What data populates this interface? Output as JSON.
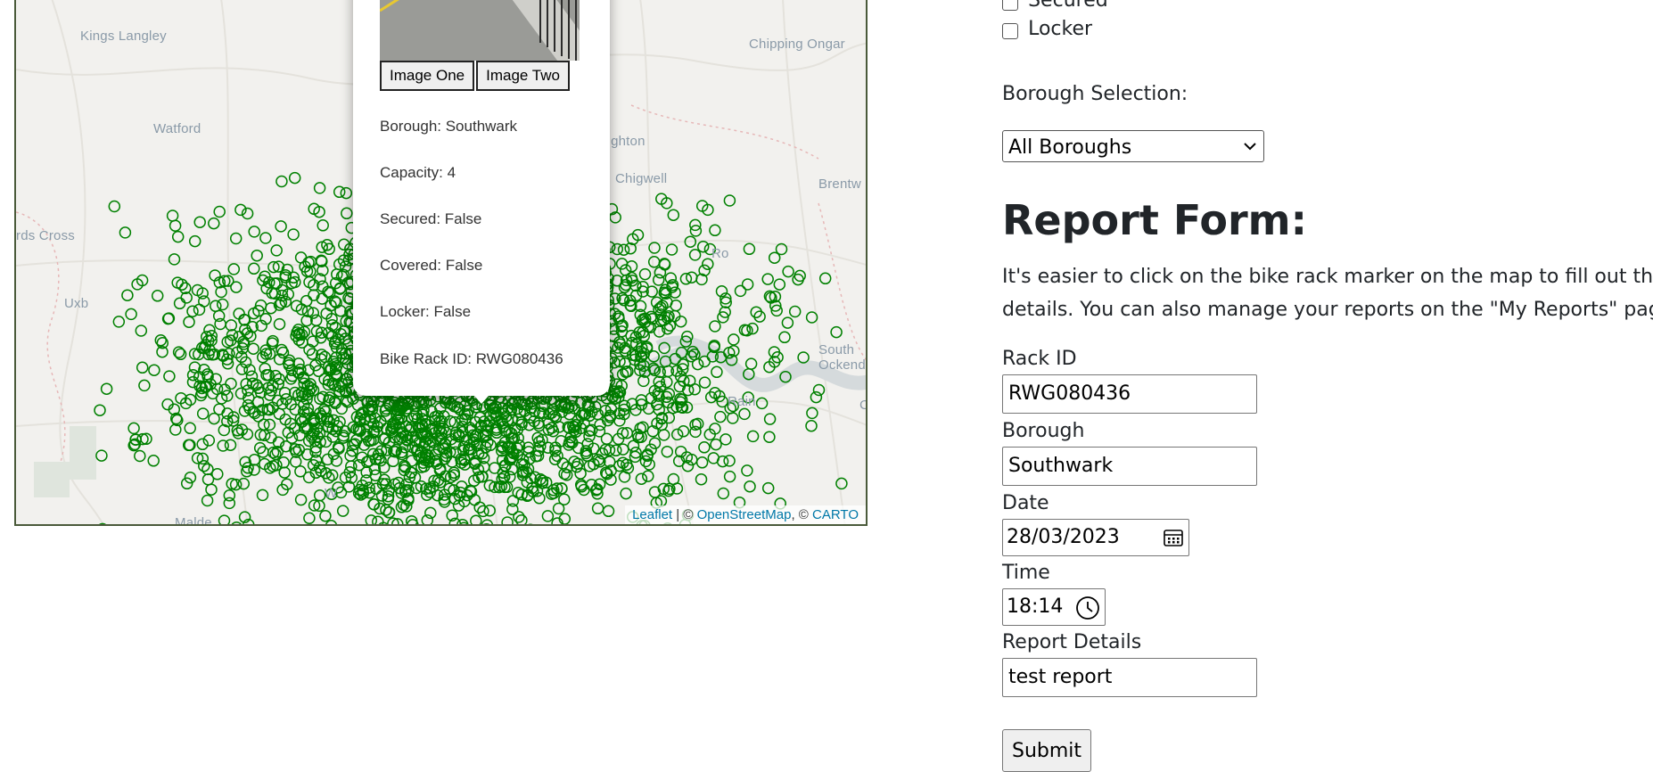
{
  "filters": {
    "secured_label": "Secured",
    "locker_label": "Locker"
  },
  "borough_selection": {
    "label": "Borough Selection:",
    "selected": "All Boroughs"
  },
  "report_form": {
    "title": "Report Form:",
    "intro_line1": "It's easier to click on the bike rack marker on the map to fill out the ra",
    "intro_line2": "details. You can also manage your reports on the \"My Reports\" page.",
    "rack_id_label": "Rack ID",
    "rack_id_value": "RWG080436",
    "borough_label": "Borough",
    "borough_value": "Southwark",
    "date_label": "Date",
    "date_value": "28/03/2023",
    "time_label": "Time",
    "time_value": "18:14",
    "details_label": "Report Details",
    "details_value": "test report",
    "submit_label": "Submit"
  },
  "map": {
    "places": [
      "Kings Langley",
      "Chipping Ongar",
      "Watford",
      "oughton",
      "Chigwell",
      "Brentw",
      "rds Cross",
      "Uxb",
      "Ro",
      "South Ockendon",
      "Rain",
      "W",
      "Malde",
      "C"
    ],
    "marker_color": "#008000",
    "attribution": {
      "leaflet": "Leaflet",
      "sep1": " | © ",
      "osm": "OpenStreetMap",
      "sep2": ", © ",
      "carto": "CARTO"
    }
  },
  "popup": {
    "image_one_label": "Image One",
    "image_two_label": "Image Two",
    "borough": "Borough: Southwark",
    "capacity": "Capacity: 4",
    "secured": "Secured: False",
    "covered": "Covered: False",
    "locker": "Locker: False",
    "rack_id": "Bike Rack ID: RWG080436"
  }
}
